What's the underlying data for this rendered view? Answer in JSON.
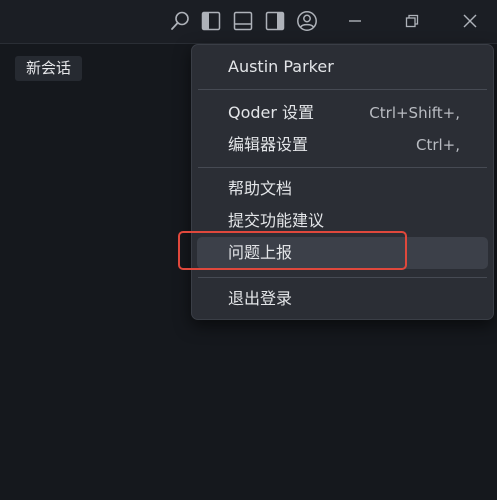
{
  "titlebar": {
    "icons": [
      "search-icon",
      "toggle-primary-sidebar-icon",
      "toggle-panel-icon",
      "toggle-secondary-sidebar-icon",
      "account-icon",
      "minimize-icon",
      "restore-icon",
      "close-icon"
    ]
  },
  "main": {
    "tab_label": "新会话"
  },
  "account_menu": {
    "user_name": "Austin Parker",
    "items": [
      {
        "label": "Qoder 设置",
        "shortcut": "Ctrl+Shift+,"
      },
      {
        "label": "编辑器设置",
        "shortcut": "Ctrl+,"
      },
      {
        "label": "帮助文档",
        "shortcut": ""
      },
      {
        "label": "提交功能建议",
        "shortcut": ""
      },
      {
        "label": "问题上报",
        "shortcut": ""
      },
      {
        "label": "退出登录",
        "shortcut": ""
      }
    ],
    "hovered_item": "问题上报"
  },
  "colors": {
    "background": "#15181d",
    "menu_background": "#2b2e35",
    "highlight_outline": "#e0483c"
  }
}
